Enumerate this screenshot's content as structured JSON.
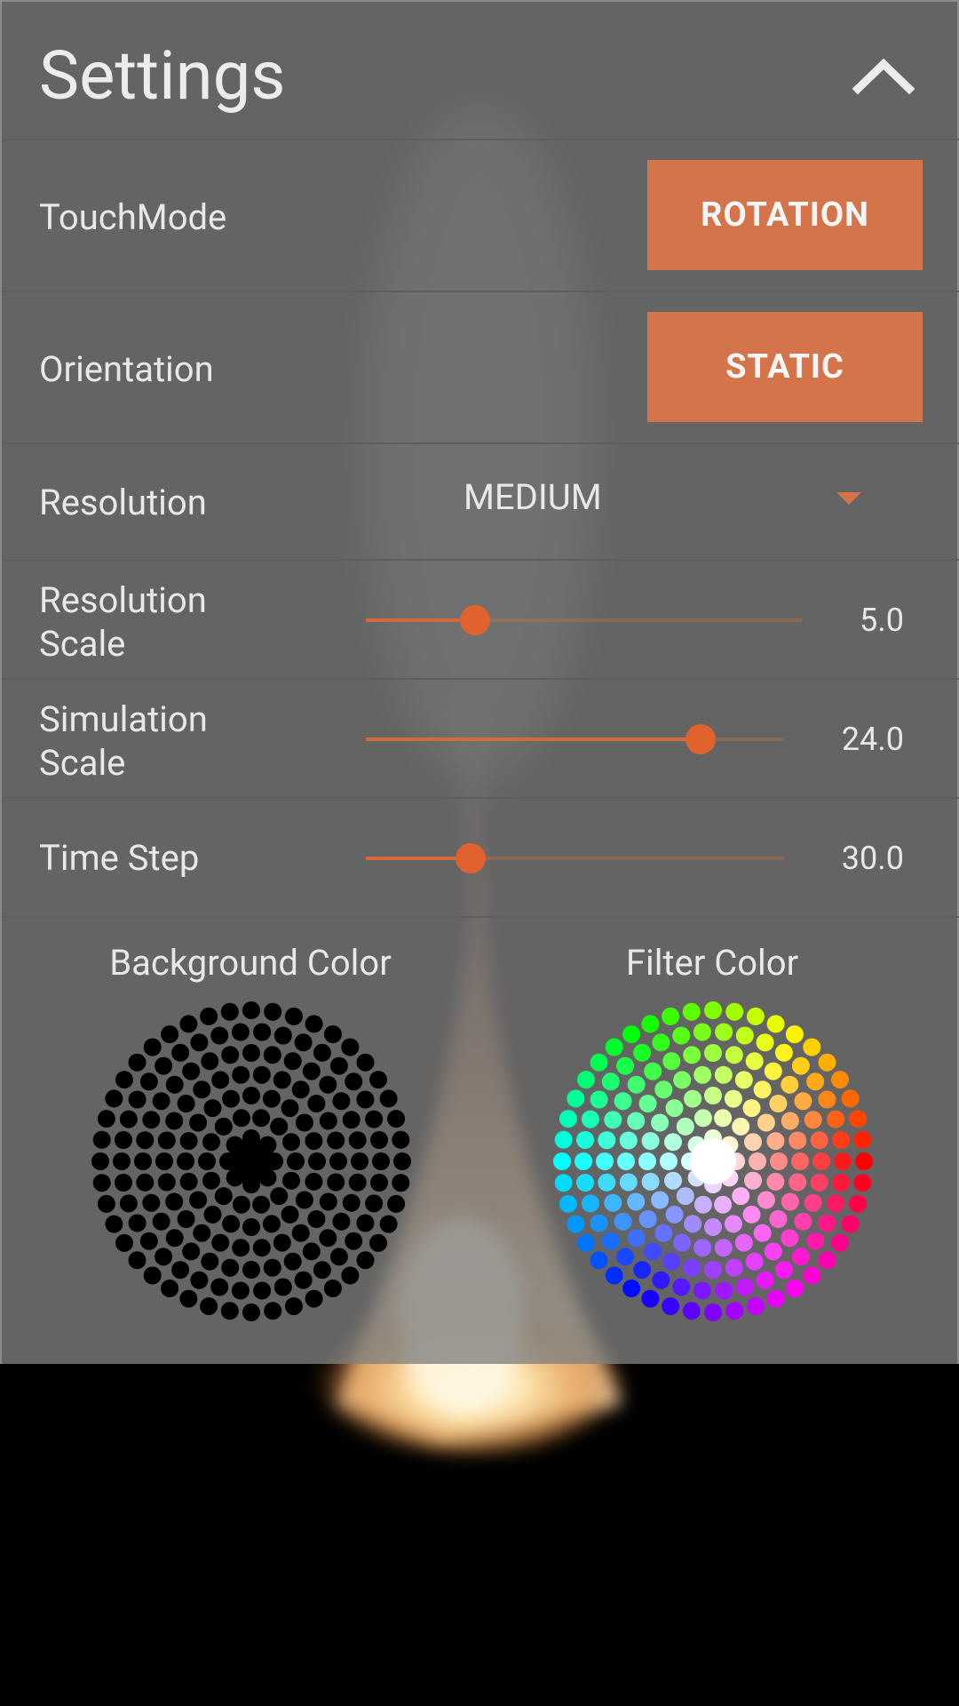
{
  "settings": {
    "title": "Settings",
    "collapse_icon": "chevron-up-icon",
    "touch_mode": {
      "label": "TouchMode",
      "button": "ROTATION"
    },
    "orientation": {
      "label": "Orientation",
      "button": "STATIC"
    },
    "resolution": {
      "label": "Resolution",
      "value": "MEDIUM"
    },
    "resolution_scale": {
      "label_line1": "Resolution",
      "label_line2": "Scale",
      "value": "5.0",
      "fraction": 0.25
    },
    "simulation_scale": {
      "label_line1": "Simulation",
      "label_line2": "Scale",
      "value": "24.0",
      "fraction": 0.8
    },
    "time_step": {
      "label": "Time Step",
      "value": "30.0",
      "fraction": 0.25
    },
    "background_color": {
      "label": "Background Color",
      "selected": "#000000"
    },
    "filter_color": {
      "label": "Filter Color",
      "selected": "#ffffff"
    }
  },
  "colors": {
    "accent": "#d4744a",
    "slider": "#e0632f"
  }
}
